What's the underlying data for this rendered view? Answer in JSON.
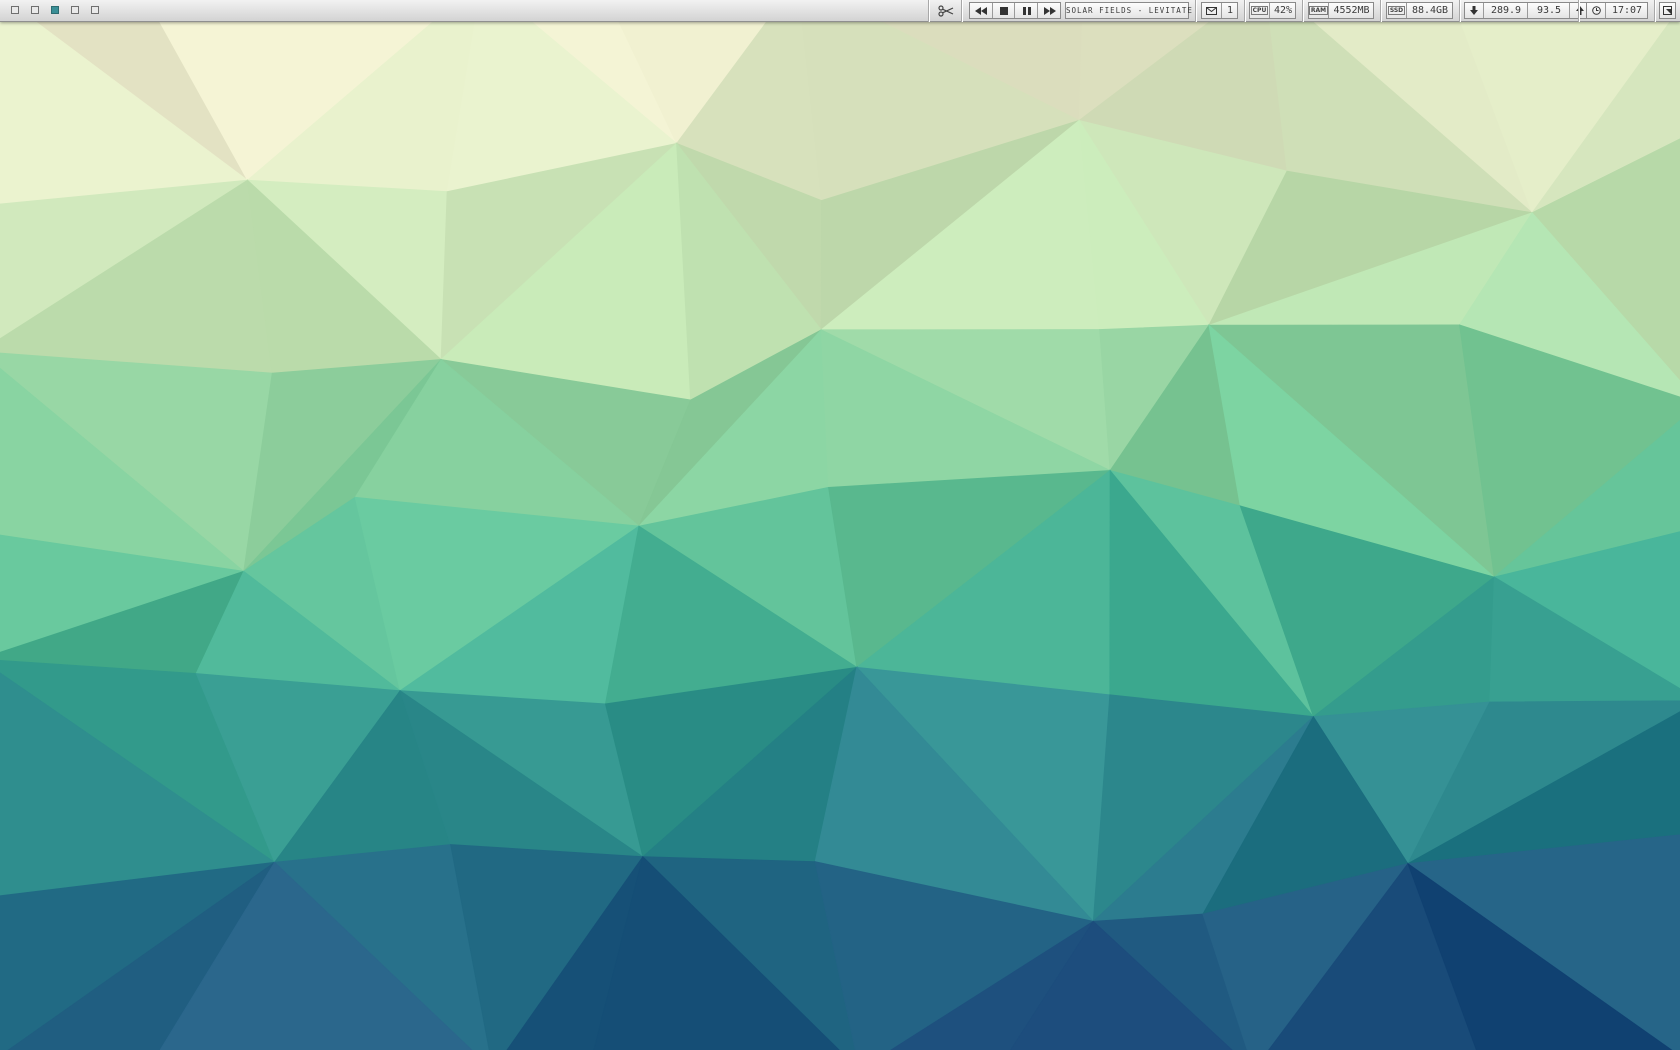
{
  "workspaces": [
    {
      "name": "workspace-1",
      "active": false
    },
    {
      "name": "workspace-2",
      "active": false
    },
    {
      "name": "workspace-3",
      "active": true
    },
    {
      "name": "workspace-4",
      "active": false
    },
    {
      "name": "workspace-5",
      "active": false
    }
  ],
  "tray": {
    "screenshot_icon": "scissors-icon",
    "media": {
      "prev_icon": "rewind-icon",
      "stop_icon": "stop-icon",
      "pause_icon": "pause-icon",
      "next_icon": "fast-forward-icon",
      "now_playing": "SOLAR FIELDS - LEVITATE"
    },
    "mail": {
      "icon": "envelope-icon",
      "count": "1"
    },
    "cpu": {
      "tag": "CPU",
      "value": "42%"
    },
    "ram": {
      "tag": "RAM",
      "value": "4552MB"
    },
    "ssd": {
      "tag": "SSD",
      "value": "88.4GB"
    },
    "network": {
      "down_icon": "arrow-down-icon",
      "down": "289.9",
      "up": "93.5",
      "up_icon": "arrow-up-icon"
    },
    "clock": {
      "icon": "clock-icon",
      "time": "17:07"
    },
    "menu_icon": "corner-menu-icon"
  },
  "colors": {
    "wallpaper_light": "#eeebcd",
    "wallpaper_mid": "#5cbf97",
    "wallpaper_dark": "#1c4a7c",
    "active_workspace": "#3a8f96"
  }
}
